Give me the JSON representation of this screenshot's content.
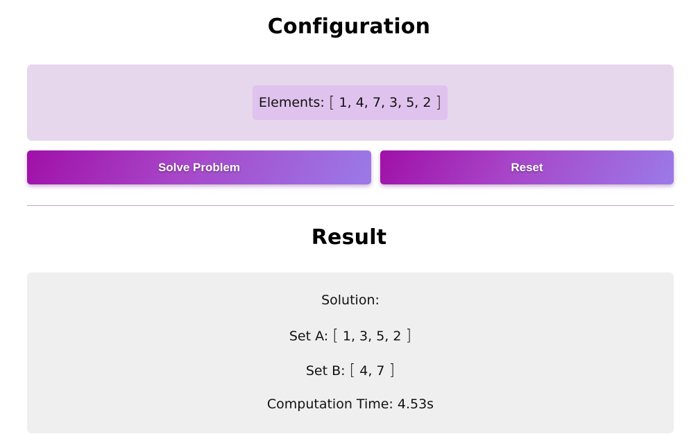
{
  "configuration": {
    "title": "Configuration",
    "elements_label": "Elements:",
    "elements_open": "[",
    "elements_values": "1, 4, 7, 3, 5, 2",
    "elements_close": "]"
  },
  "buttons": {
    "solve_label": "Solve Problem",
    "reset_label": "Reset"
  },
  "result": {
    "title": "Result",
    "solution_label": "Solution:",
    "set_a_label": "Set A:",
    "set_a_values": "1, 3, 5, 2",
    "set_b_label": "Set B:",
    "set_b_values": "4, 7",
    "time_label": "Computation Time:",
    "time_value": "4.53s"
  },
  "colors": {
    "config_panel": "#e6d7ec",
    "elements_chip": "#dfc2ed",
    "button_gradient_start": "#a010a8",
    "button_gradient_end": "#9b7ae8",
    "divider": "#cf9bd8",
    "result_panel": "#efefef"
  }
}
